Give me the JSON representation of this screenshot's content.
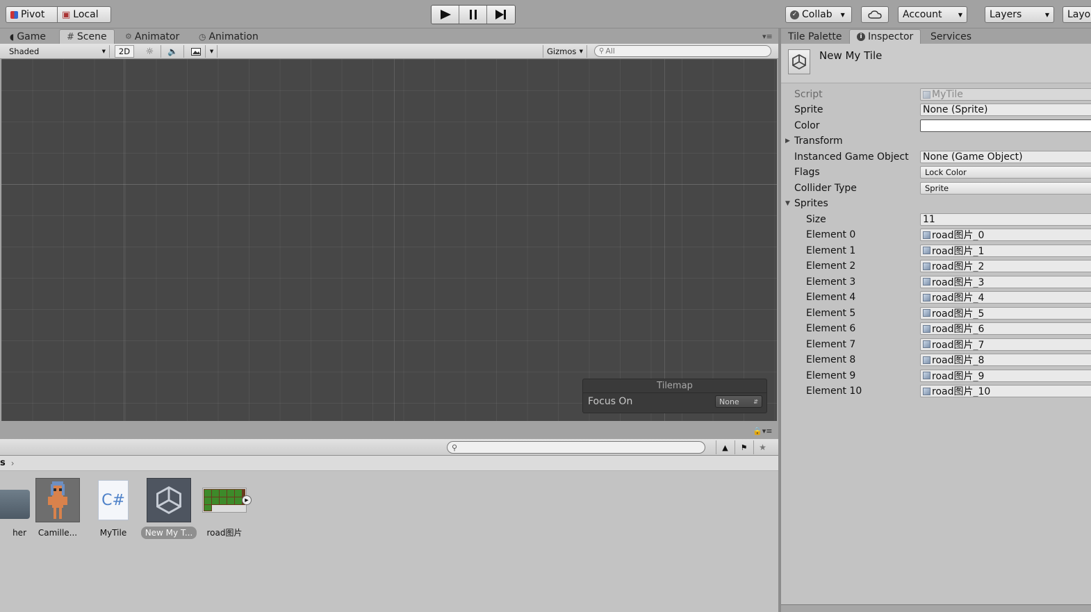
{
  "toolbar": {
    "pivot": "Pivot",
    "local": "Local",
    "collab": "Collab",
    "account": "Account",
    "layers": "Layers",
    "layout": "Layo"
  },
  "scene_tabs": [
    "Game",
    "Scene",
    "Animator",
    "Animation"
  ],
  "scene_toolbar": {
    "shading": "Shaded",
    "mode2d": "2D",
    "gizmos": "Gizmos",
    "search_placeholder": "All"
  },
  "tilemap_overlay": {
    "title": "Tilemap",
    "focus_label": "Focus On",
    "focus_value": "None"
  },
  "project": {
    "breadcrumb": "s",
    "assets": [
      {
        "name": "her"
      },
      {
        "name": "Camille..."
      },
      {
        "name": "MyTile",
        "glyph": "C#"
      },
      {
        "name": "New My T...",
        "selected": true
      },
      {
        "name": "road图片"
      }
    ]
  },
  "inspector_tabs": [
    "Tile Palette",
    "Inspector",
    "Services"
  ],
  "inspector": {
    "title": "New My Tile",
    "script_label": "Script",
    "script_value": "MyTile",
    "sprite_label": "Sprite",
    "sprite_value": "None (Sprite)",
    "color_label": "Color",
    "transform_label": "Transform",
    "instanced_label": "Instanced Game Object",
    "instanced_value": "None (Game Object)",
    "flags_label": "Flags",
    "flags_value": "Lock Color",
    "collider_label": "Collider Type",
    "collider_value": "Sprite",
    "sprites_label": "Sprites",
    "size_label": "Size",
    "size_value": "11",
    "elements": [
      {
        "label": "Element 0",
        "value": "road图片_0"
      },
      {
        "label": "Element 1",
        "value": "road图片_1"
      },
      {
        "label": "Element 2",
        "value": "road图片_2"
      },
      {
        "label": "Element 3",
        "value": "road图片_3"
      },
      {
        "label": "Element 4",
        "value": "road图片_4"
      },
      {
        "label": "Element 5",
        "value": "road图片_5"
      },
      {
        "label": "Element 6",
        "value": "road图片_6"
      },
      {
        "label": "Element 7",
        "value": "road图片_7"
      },
      {
        "label": "Element 8",
        "value": "road图片_8"
      },
      {
        "label": "Element 9",
        "value": "road图片_9"
      },
      {
        "label": "Element 10",
        "value": "road图片_10"
      }
    ]
  }
}
